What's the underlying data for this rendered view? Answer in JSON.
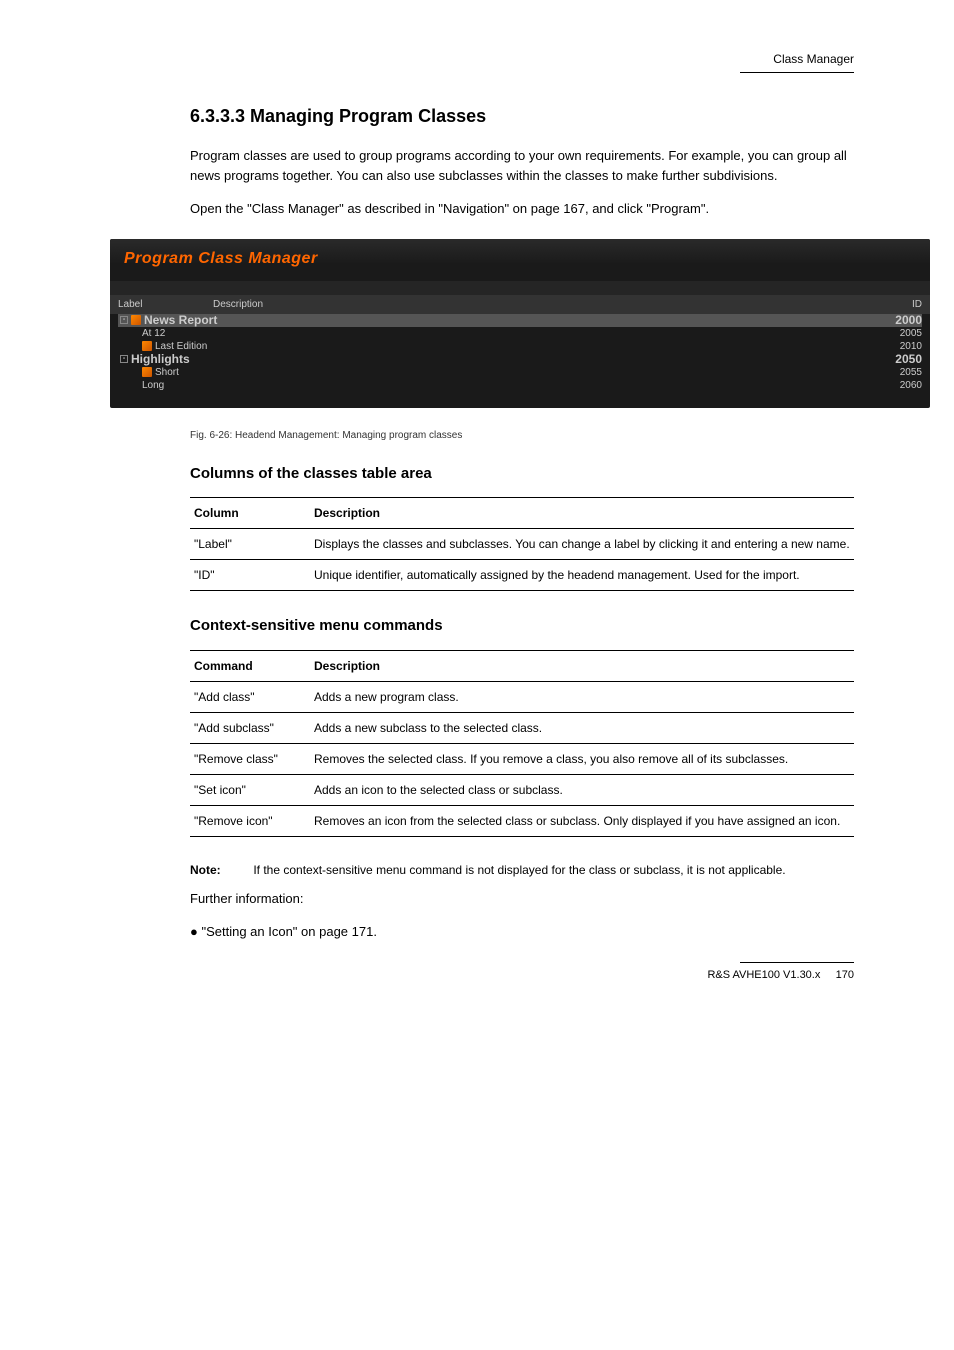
{
  "page": {
    "headerTopRight": "Class Manager",
    "footerLeft": "R&S AVHE100 V1.30.x",
    "footerRight": "170"
  },
  "section": {
    "title": "6.3.3.3 Managing Program Classes",
    "intro": "Program classes are used to group programs according to your own requirements. For example, you can group all news programs together. You can also use subclasses within the classes to make further subdivisions.",
    "openPath": "Open the \"Class Manager\" as described in \"Navigation\" on page 167, and click \"Program\"."
  },
  "screenshot": {
    "windowTitle": "Program Class Manager",
    "columns": {
      "label": "Label",
      "description": "Description",
      "id": "ID"
    },
    "tree": [
      {
        "level": 0,
        "kind": "parent",
        "label": "News Report",
        "id": "2000",
        "selected": true,
        "toggle": "-",
        "icon": true
      },
      {
        "level": 1,
        "kind": "child",
        "label": "At 12",
        "id": "2005"
      },
      {
        "level": 1,
        "kind": "child",
        "label": "Last Edition",
        "id": "2010",
        "icon": true
      },
      {
        "level": 0,
        "kind": "parent",
        "label": "Highlights",
        "id": "2050",
        "toggle": "-"
      },
      {
        "level": 1,
        "kind": "child",
        "label": "Short",
        "id": "2055",
        "icon": true
      },
      {
        "level": 1,
        "kind": "child",
        "label": "Long",
        "id": "2060"
      }
    ],
    "caption": "Fig. 6-26: Headend Management: Managing program classes"
  },
  "columnsTable": {
    "heading": "Columns of the classes table area",
    "head": {
      "c1": "Column",
      "c2": "Description"
    },
    "rows": [
      {
        "c1": "\"Label\"",
        "c2": "Displays the classes and subclasses. You can change a label by clicking it and entering a new name.",
        "last": false
      },
      {
        "c1": "\"ID\"",
        "c2": "Unique identifier, automatically assigned by the headend management. Used for the import.",
        "last": true
      }
    ]
  },
  "contextTable": {
    "heading": "Context-sensitive menu commands",
    "head": {
      "c1": "Command",
      "c2": "Description"
    },
    "rows": [
      {
        "c1": "\"Add class\"",
        "c2": "Adds a new program class.",
        "last": false
      },
      {
        "c1": "\"Add subclass\"",
        "c2": "Adds a new subclass to the selected class.",
        "last": false
      },
      {
        "c1": "\"Remove class\"",
        "c2": "Removes the selected class. If you remove a class, you also remove all of its subclasses.",
        "last": false
      },
      {
        "c1": "\"Set icon\"",
        "c2": "Adds an icon to the selected class or subclass.",
        "last": false
      },
      {
        "c1": "\"Remove icon\"",
        "c2": "Removes an icon from the selected class or subclass. Only displayed if you have assigned an icon.",
        "last": true
      }
    ]
  },
  "note": {
    "label": "Note:",
    "text": "If the context-sensitive menu command is not displayed for the class or subclass, it is not applicable."
  },
  "furtherInfo": {
    "heading": "Further information:",
    "item": "\"Setting an Icon\" on page 171."
  }
}
